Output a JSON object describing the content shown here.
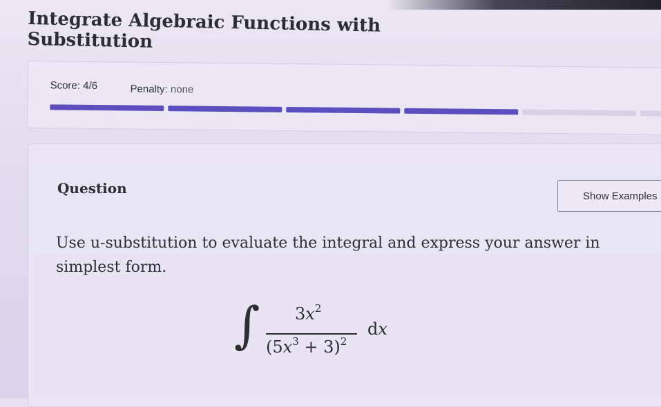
{
  "header": {
    "title": "Integrate Algebraic Functions with Substitution"
  },
  "score": {
    "label": "Score: 4/6",
    "penalty_label": "Penalty:",
    "penalty_value": "none",
    "progress": {
      "completed_segments": 4,
      "total_segments": 6
    }
  },
  "question": {
    "heading": "Question",
    "show_examples_label": "Show Examples",
    "prompt": "Use u-substitution to evaluate the integral and express your answer in simplest form.",
    "integral": {
      "sign": "∫",
      "numerator_coef": "3",
      "numerator_var": "x",
      "numerator_exp": "2",
      "denom_open": "(5",
      "denom_var": "x",
      "denom_inner_exp": "3",
      "denom_rest": " + 3)",
      "denom_outer_exp": "2",
      "differential_d": "d",
      "differential_var": "x"
    }
  },
  "colors": {
    "progress_filled": "#5b4fbf",
    "progress_empty": "#d6d2e3",
    "text": "#2d2d33"
  }
}
